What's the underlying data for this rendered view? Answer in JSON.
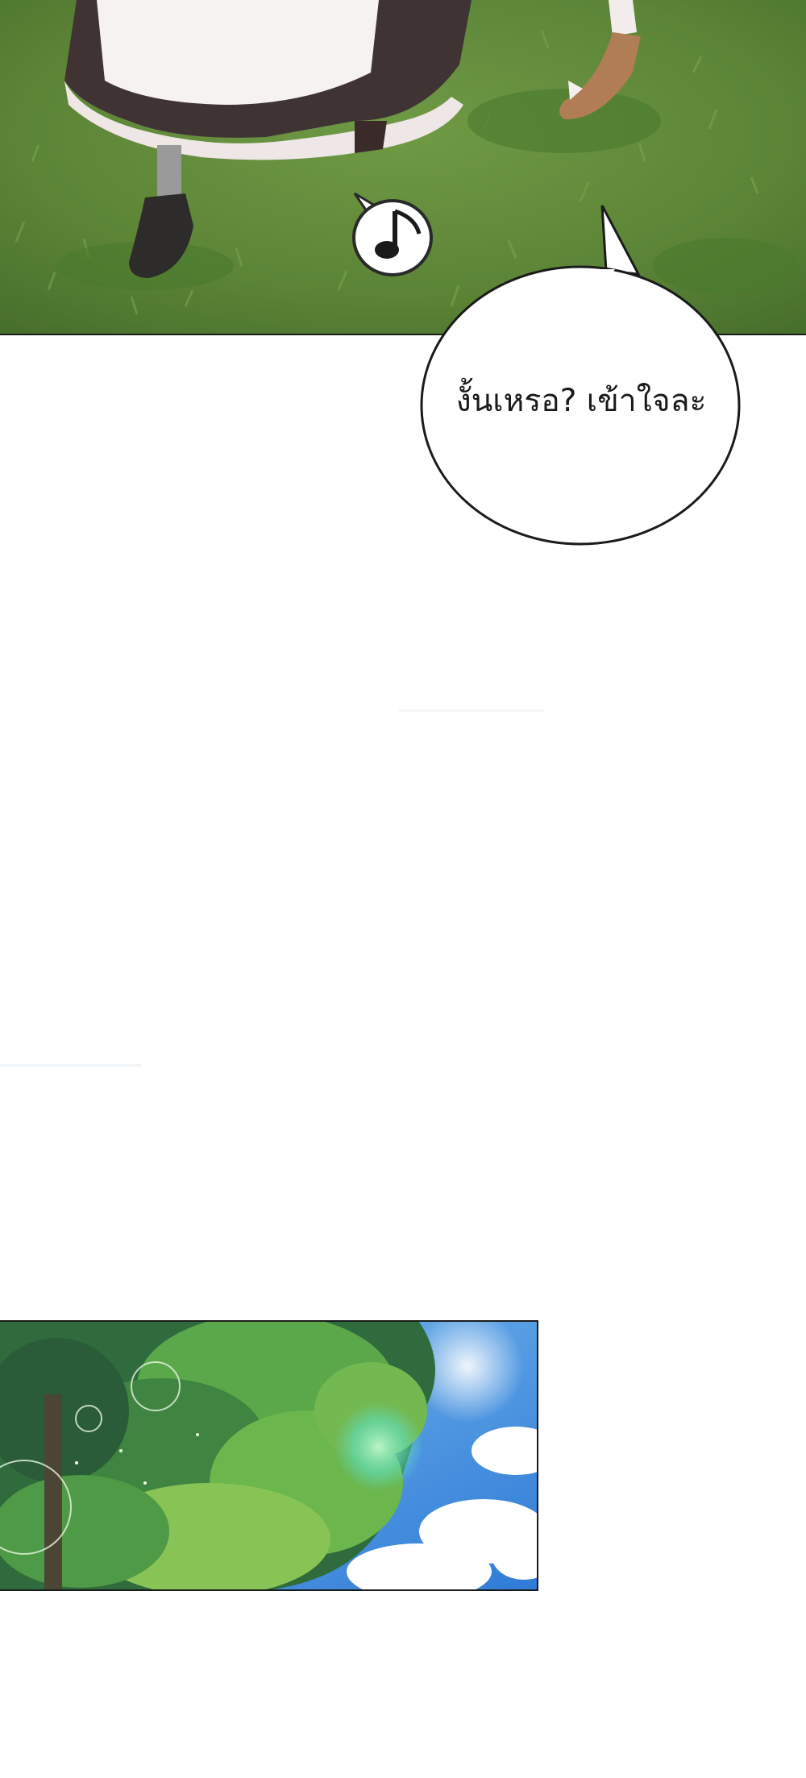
{
  "panels": [
    {
      "id": "top-panel",
      "scene": "grass-and-feet"
    },
    {
      "id": "bottom-panel",
      "scene": "tree-canopy-sky"
    }
  ],
  "speech_bubble": {
    "text": "งั้นเหรอ? เข้าใจละ"
  },
  "sound_effect_icon": "music-note-icon",
  "colors": {
    "grass": "#5f8a3a",
    "sky": "#3c86d8",
    "foliage": "#4f9a3e",
    "border": "#1b1b1b"
  }
}
